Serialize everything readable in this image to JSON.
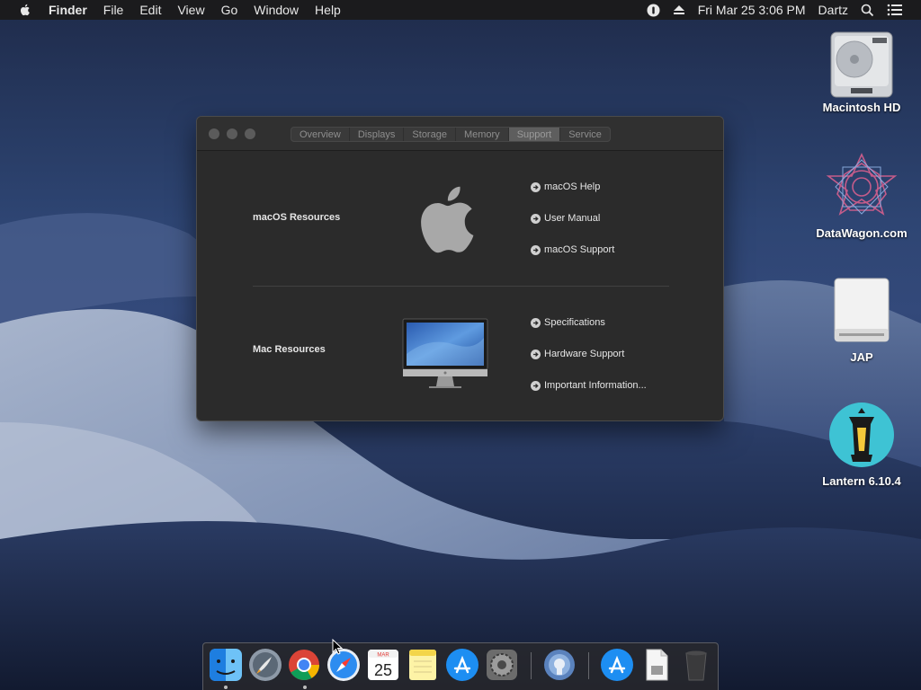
{
  "menubar": {
    "app_name": "Finder",
    "items": [
      "File",
      "Edit",
      "View",
      "Go",
      "Window",
      "Help"
    ],
    "clock": "Fri Mar 25  3:06 PM",
    "user": "Dartz",
    "status_icons": [
      "1password-icon",
      "eject-icon",
      "search-icon",
      "list-icon"
    ]
  },
  "window": {
    "tabs": [
      "Overview",
      "Displays",
      "Storage",
      "Memory",
      "Support",
      "Service"
    ],
    "active_tab": "Support",
    "sections": [
      {
        "label": "macOS Resources",
        "links": [
          "macOS Help",
          "User Manual",
          "macOS Support"
        ]
      },
      {
        "label": "Mac Resources",
        "links": [
          "Specifications",
          "Hardware Support",
          "Important Information..."
        ]
      }
    ]
  },
  "desktop_icons": [
    {
      "label": "Macintosh HD",
      "icon": "hard-drive-icon"
    },
    {
      "label": "DataWagon.com",
      "icon": "datawagon-icon"
    },
    {
      "label": "JAP",
      "icon": "external-drive-icon"
    },
    {
      "label": "Lantern 6.10.4",
      "icon": "lantern-icon"
    }
  ],
  "dock": {
    "apps": [
      "finder-icon",
      "launchpad-icon",
      "chrome-icon",
      "safari-icon",
      "calendar-icon",
      "notes-icon",
      "app-store-icon",
      "system-preferences-icon",
      "network-utility-icon",
      "app-store-icon",
      "document-icon",
      "trash-icon"
    ],
    "calendar": {
      "month": "MAR",
      "day": "25"
    }
  },
  "colors": {
    "menubar_bg": "#1b1b1d",
    "window_bg": "#2b2b2b",
    "desktop_bg": "#2e4573"
  }
}
